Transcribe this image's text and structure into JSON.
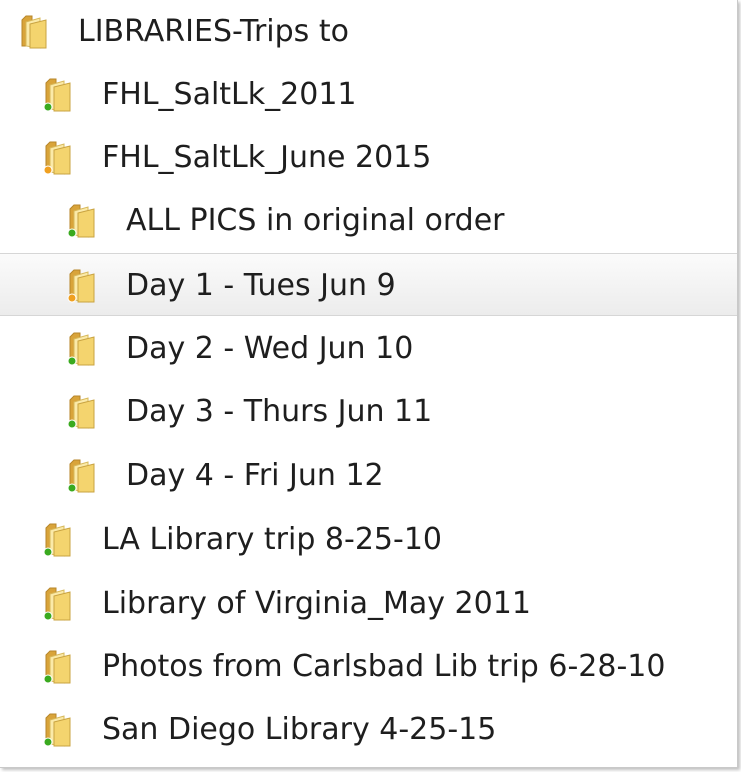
{
  "tree": {
    "items": [
      {
        "label": "LIBRARIES-Trips to",
        "level": 0,
        "icon": "folder-icon",
        "overlay": "none",
        "selected": false
      },
      {
        "label": "FHL_SaltLk_2011",
        "level": 1,
        "icon": "folder-icon",
        "overlay": "green",
        "selected": false
      },
      {
        "label": "FHL_SaltLk_June 2015",
        "level": 1,
        "icon": "folder-icon",
        "overlay": "orange",
        "selected": false
      },
      {
        "label": "ALL PICS in original order",
        "level": 2,
        "icon": "folder-icon",
        "overlay": "green",
        "selected": false
      },
      {
        "label": "Day 1 - Tues Jun 9",
        "level": 2,
        "icon": "folder-icon",
        "overlay": "orange",
        "selected": true
      },
      {
        "label": "Day 2 - Wed Jun 10",
        "level": 2,
        "icon": "folder-icon",
        "overlay": "green",
        "selected": false
      },
      {
        "label": "Day 3 - Thurs Jun 11",
        "level": 2,
        "icon": "folder-icon",
        "overlay": "green",
        "selected": false
      },
      {
        "label": "Day 4 - Fri Jun 12",
        "level": 2,
        "icon": "folder-icon",
        "overlay": "green",
        "selected": false
      },
      {
        "label": "LA Library trip 8-25-10",
        "level": 1,
        "icon": "folder-icon",
        "overlay": "green",
        "selected": false
      },
      {
        "label": "Library of Virginia_May 2011",
        "level": 1,
        "icon": "folder-icon",
        "overlay": "green",
        "selected": false
      },
      {
        "label": "Photos from Carlsbad Lib trip 6-28-10",
        "level": 1,
        "icon": "folder-icon",
        "overlay": "green",
        "selected": false
      },
      {
        "label": "San Diego Library 4-25-15",
        "level": 1,
        "icon": "folder-icon",
        "overlay": "green",
        "selected": false
      }
    ]
  },
  "colors": {
    "folder_back": "#d9a43a",
    "folder_front": "#f4d46e",
    "overlay_green": "#3aaa1f",
    "overlay_orange": "#f0a020",
    "selection": "#ececec"
  }
}
